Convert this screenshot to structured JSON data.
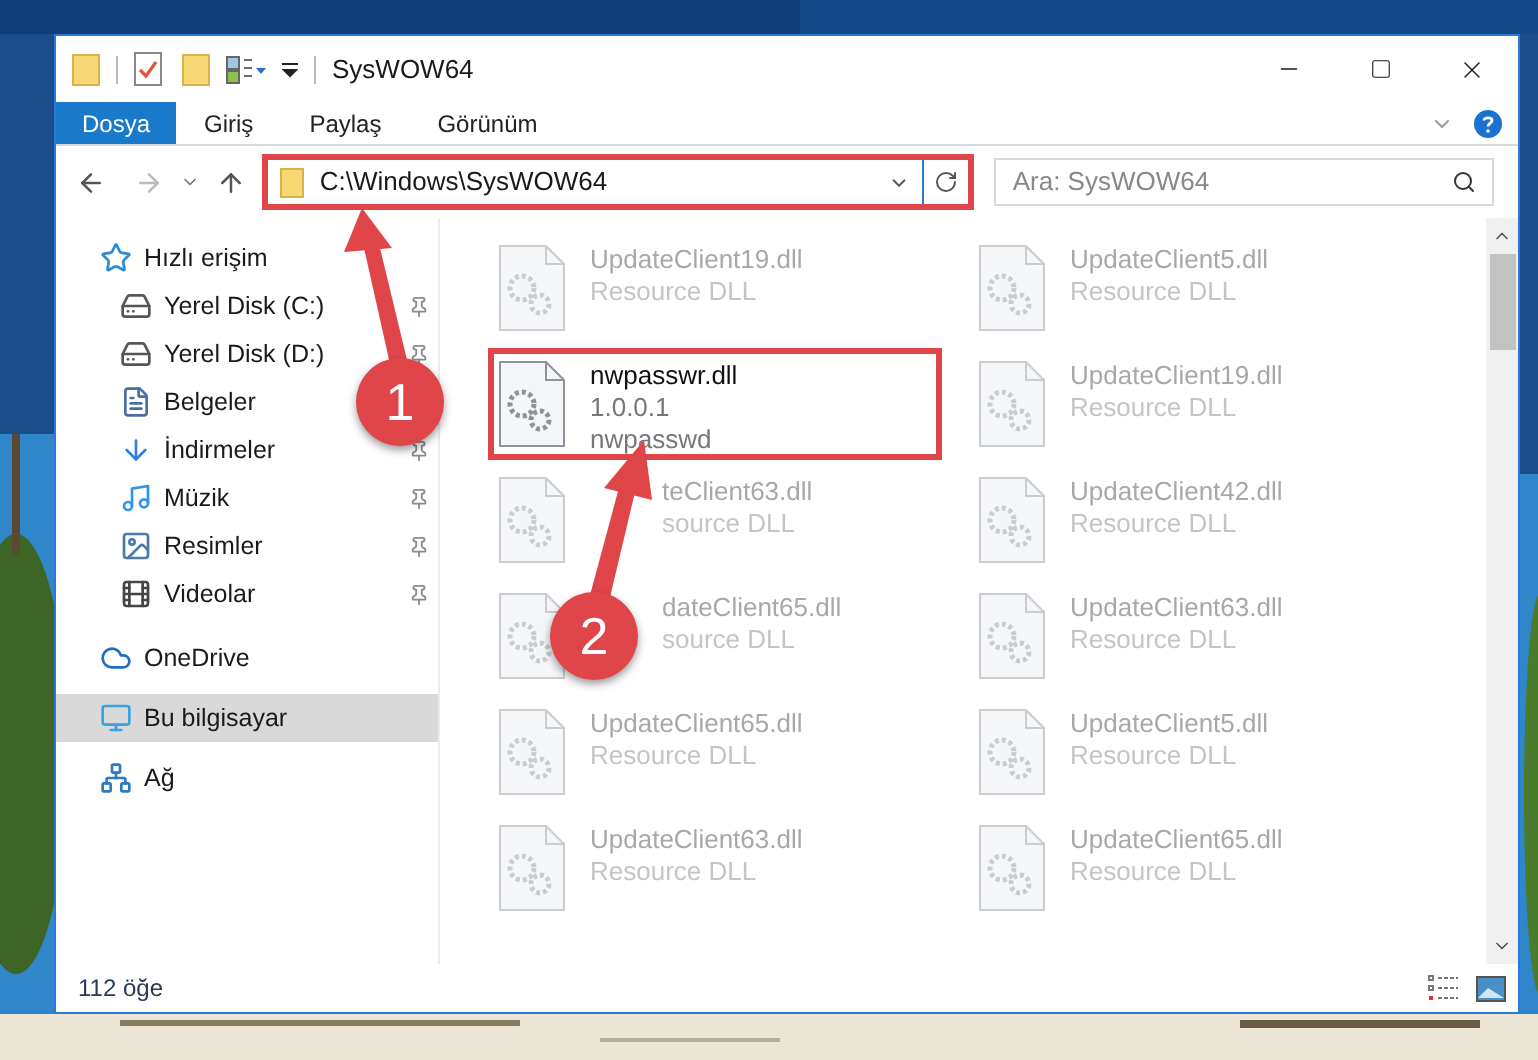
{
  "window": {
    "title": "SysWOW64"
  },
  "ribbon_tabs": [
    {
      "label": "Dosya",
      "selected": true
    },
    {
      "label": "Giriş",
      "selected": false
    },
    {
      "label": "Paylaş",
      "selected": false
    },
    {
      "label": "Görünüm",
      "selected": false
    }
  ],
  "address_bar": {
    "path": "C:\\Windows\\SysWOW64",
    "marked": true
  },
  "search": {
    "placeholder": "Ara: SysWOW64"
  },
  "sidebar": {
    "items": [
      {
        "label": "Hızlı erişim",
        "selected": false,
        "children": [
          {
            "label": "Yerel Disk (C:)",
            "pinned": true
          },
          {
            "label": "Yerel Disk (D:)",
            "pinned": true
          },
          {
            "label": "Belgeler"
          },
          {
            "label": "İndirmeler",
            "pinned": true
          },
          {
            "label": "Müzik",
            "pinned": true
          },
          {
            "label": "Resimler",
            "pinned": true
          },
          {
            "label": "Videolar",
            "pinned": true
          }
        ]
      },
      {
        "label": "OneDrive",
        "selected": false
      },
      {
        "label": "Bu bilgisayar",
        "selected": true
      },
      {
        "label": "Ağ",
        "selected": false
      }
    ]
  },
  "files": [
    {
      "name": "UpdateClient19.dll",
      "details": [
        "Resource DLL"
      ],
      "dimmed": true,
      "marked": false,
      "covered": false
    },
    {
      "name": "UpdateClient5.dll",
      "details": [
        "Resource DLL"
      ],
      "dimmed": true,
      "marked": false,
      "covered": false
    },
    {
      "name": "nwpasswr.dll",
      "details": [
        "1.0.0.1",
        "nwpasswd"
      ],
      "dimmed": false,
      "marked": true,
      "covered": false
    },
    {
      "name": "UpdateClient19.dll",
      "details": [
        "Resource DLL"
      ],
      "dimmed": true,
      "marked": false,
      "covered": false
    },
    {
      "name": "teClient63.dll",
      "details": [
        "source DLL"
      ],
      "dimmed": true,
      "marked": false,
      "covered": true
    },
    {
      "name": "UpdateClient42.dll",
      "details": [
        "Resource DLL"
      ],
      "dimmed": true,
      "marked": false,
      "covered": false
    },
    {
      "name": "dateClient65.dll",
      "details": [
        "source DLL"
      ],
      "dimmed": true,
      "marked": false,
      "covered": true
    },
    {
      "name": "UpdateClient63.dll",
      "details": [
        "Resource DLL"
      ],
      "dimmed": true,
      "marked": false,
      "covered": false
    },
    {
      "name": "UpdateClient65.dll",
      "details": [
        "Resource DLL"
      ],
      "dimmed": true,
      "marked": false,
      "covered": false
    },
    {
      "name": "UpdateClient5.dll",
      "details": [
        "Resource DLL"
      ],
      "dimmed": true,
      "marked": false,
      "covered": false
    },
    {
      "name": "UpdateClient63.dll",
      "details": [
        "Resource DLL"
      ],
      "dimmed": true,
      "marked": false,
      "covered": false
    },
    {
      "name": "UpdateClient65.dll",
      "details": [
        "Resource DLL"
      ],
      "dimmed": true,
      "marked": false,
      "covered": false
    }
  ],
  "status_bar": {
    "count": "112 öğe"
  },
  "annotations": [
    {
      "label": "1"
    },
    {
      "label": "2"
    }
  ]
}
